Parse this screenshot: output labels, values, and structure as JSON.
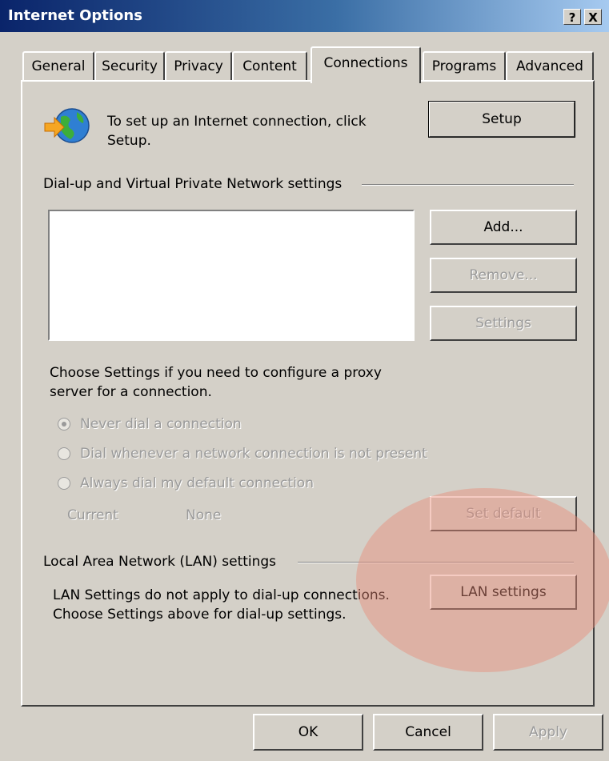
{
  "window": {
    "title": "Internet Options",
    "help_glyph": "?",
    "close_glyph": "X"
  },
  "tabs": [
    {
      "label": "General"
    },
    {
      "label": "Security"
    },
    {
      "label": "Privacy"
    },
    {
      "label": "Content"
    },
    {
      "label": "Connections"
    },
    {
      "label": "Programs"
    },
    {
      "label": "Advanced"
    }
  ],
  "active_tab": "Connections",
  "setup_section": {
    "icon": "globe-connection-icon",
    "text_line1": "To set up an Internet connection, click",
    "text_line2": "Setup.",
    "button_label": "Setup"
  },
  "dialup_section": {
    "header": "Dial-up and Virtual Private Network settings",
    "connections": [],
    "add_label": "Add...",
    "remove_label": "Remove...",
    "settings_label": "Settings",
    "proxy_text_line1": "Choose Settings if you need to configure a proxy",
    "proxy_text_line2": "server for a connection.",
    "radios": [
      {
        "label": "Never dial a connection",
        "checked": true
      },
      {
        "label": "Dial whenever a network connection is not present",
        "checked": false
      },
      {
        "label": "Always dial my default connection",
        "checked": false
      }
    ],
    "current_label": "Current",
    "current_value": "None",
    "set_default_label": "Set default"
  },
  "lan_section": {
    "header": "Local Area Network (LAN) settings",
    "text_line1": "LAN Settings do not apply to dial-up connections.",
    "text_line2": "Choose Settings above for dial-up settings.",
    "button_label": "LAN settings"
  },
  "footer": {
    "ok_label": "OK",
    "cancel_label": "Cancel",
    "apply_label": "Apply"
  },
  "colors": {
    "dialog_bg": "#d4d0c8",
    "titlebar_start": "#0a246a",
    "highlight": "#e88c78"
  }
}
